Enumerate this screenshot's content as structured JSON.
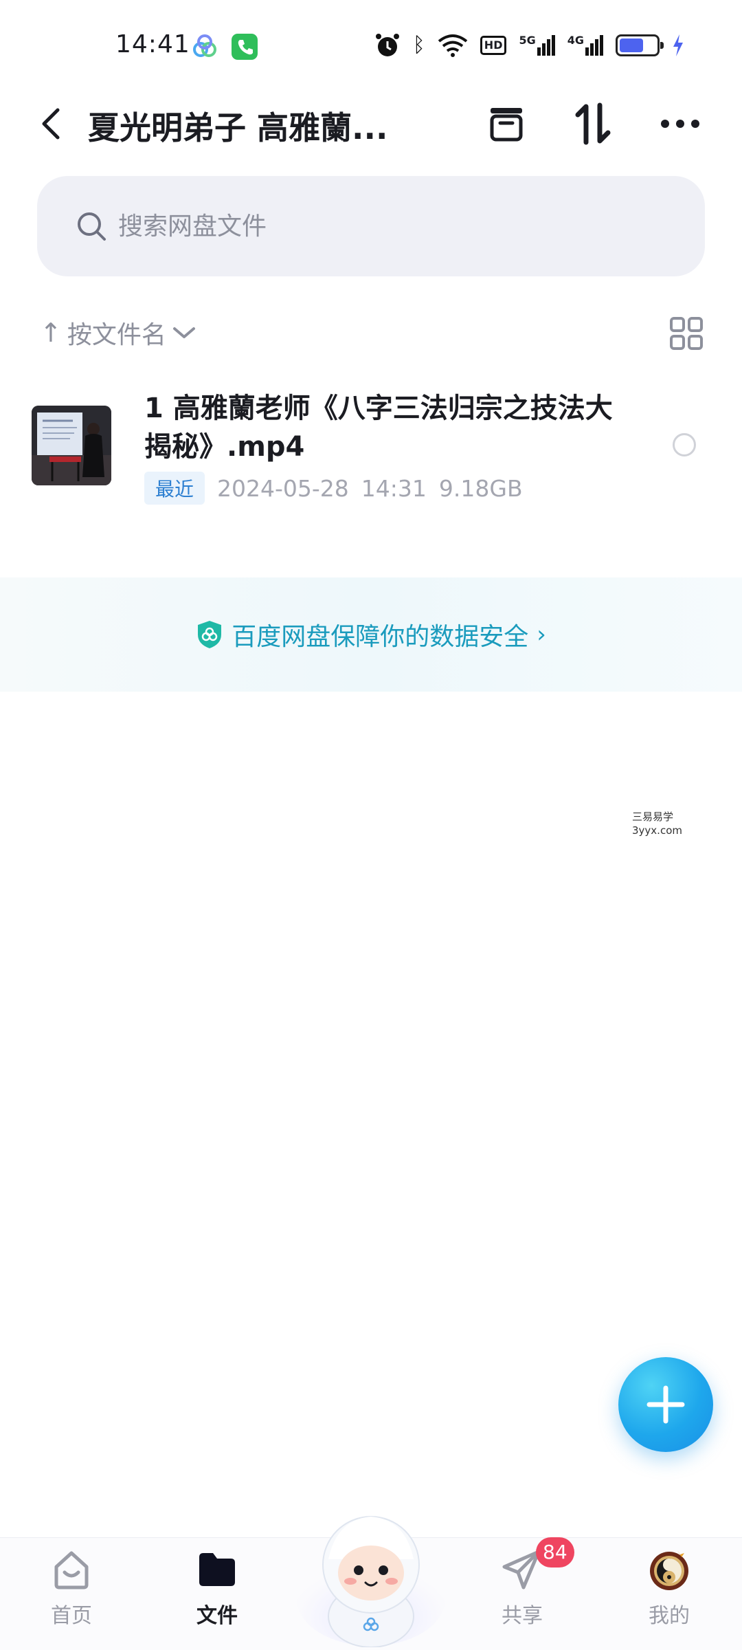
{
  "status_bar": {
    "time": "14:41",
    "network_5g": "5G",
    "network_4g": "4G",
    "hd_label": "HD",
    "battery_level": 0.65,
    "battery_color": "#4d63ef"
  },
  "header": {
    "title": "夏光明弟子 高雅蘭...",
    "icons": [
      "back-icon",
      "archive-icon",
      "sort-order-icon",
      "more-icon"
    ]
  },
  "search": {
    "placeholder": "搜索网盘文件"
  },
  "sort": {
    "arrow": "↑",
    "label": "按文件名"
  },
  "files": [
    {
      "name": "1 高雅蘭老师《八字三法归宗之技法大揭秘》.mp4",
      "badge": "最近",
      "date": "2024-05-28",
      "time": "14:31",
      "size": "9.18GB"
    }
  ],
  "safety_banner": {
    "text": "百度网盘保障你的数据安全",
    "chevron": "›"
  },
  "watermark": {
    "line1": "三易易学",
    "line2": "3yyx.com"
  },
  "bottom_nav": {
    "items": [
      {
        "label": "首页",
        "icon": "home-icon"
      },
      {
        "label": "文件",
        "icon": "folder-icon",
        "active": true
      },
      {
        "label": "共享",
        "icon": "share-icon"
      },
      {
        "label": "我的",
        "icon": "avatar"
      }
    ],
    "share_badge": "84"
  },
  "colors": {
    "accent": "#1ea7ec",
    "banner_text": "#1a9bbd",
    "badge_red": "#ef4560"
  }
}
